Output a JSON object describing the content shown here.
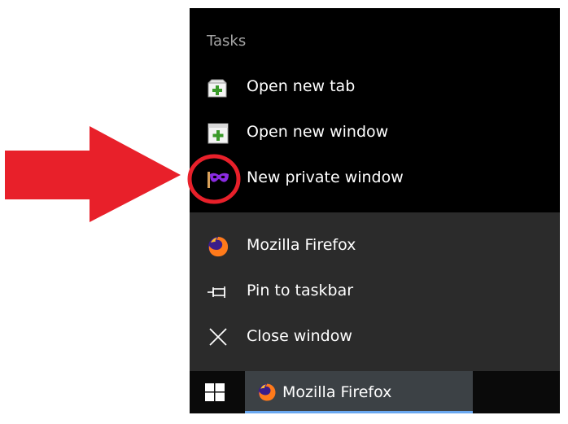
{
  "jumplist": {
    "tasks_title": "Tasks",
    "tasks": [
      {
        "label": "Open new tab",
        "icon": "new-tab-icon"
      },
      {
        "label": "Open new window",
        "icon": "new-window-icon"
      },
      {
        "label": "New private window",
        "icon": "private-mask-icon"
      }
    ],
    "bottom_items": [
      {
        "label": "Mozilla Firefox",
        "icon": "firefox-icon"
      },
      {
        "label": "Pin to taskbar",
        "icon": "pin-icon"
      },
      {
        "label": "Close window",
        "icon": "close-icon"
      }
    ]
  },
  "taskbar": {
    "start_icon": "windows-logo-icon",
    "app_label": "Mozilla Firefox",
    "app_icon": "firefox-icon"
  },
  "colors": {
    "menu_bg_top": "#000000",
    "menu_bg_bottom": "#2b2b2b",
    "taskbar_bg": "#0a0a0a",
    "active_app_bg": "#3c4145",
    "active_underline": "#6aa8f0",
    "annotation_red": "#e8202a",
    "mask_purple": "#8a2be2",
    "plus_green": "#3a9a2a"
  }
}
